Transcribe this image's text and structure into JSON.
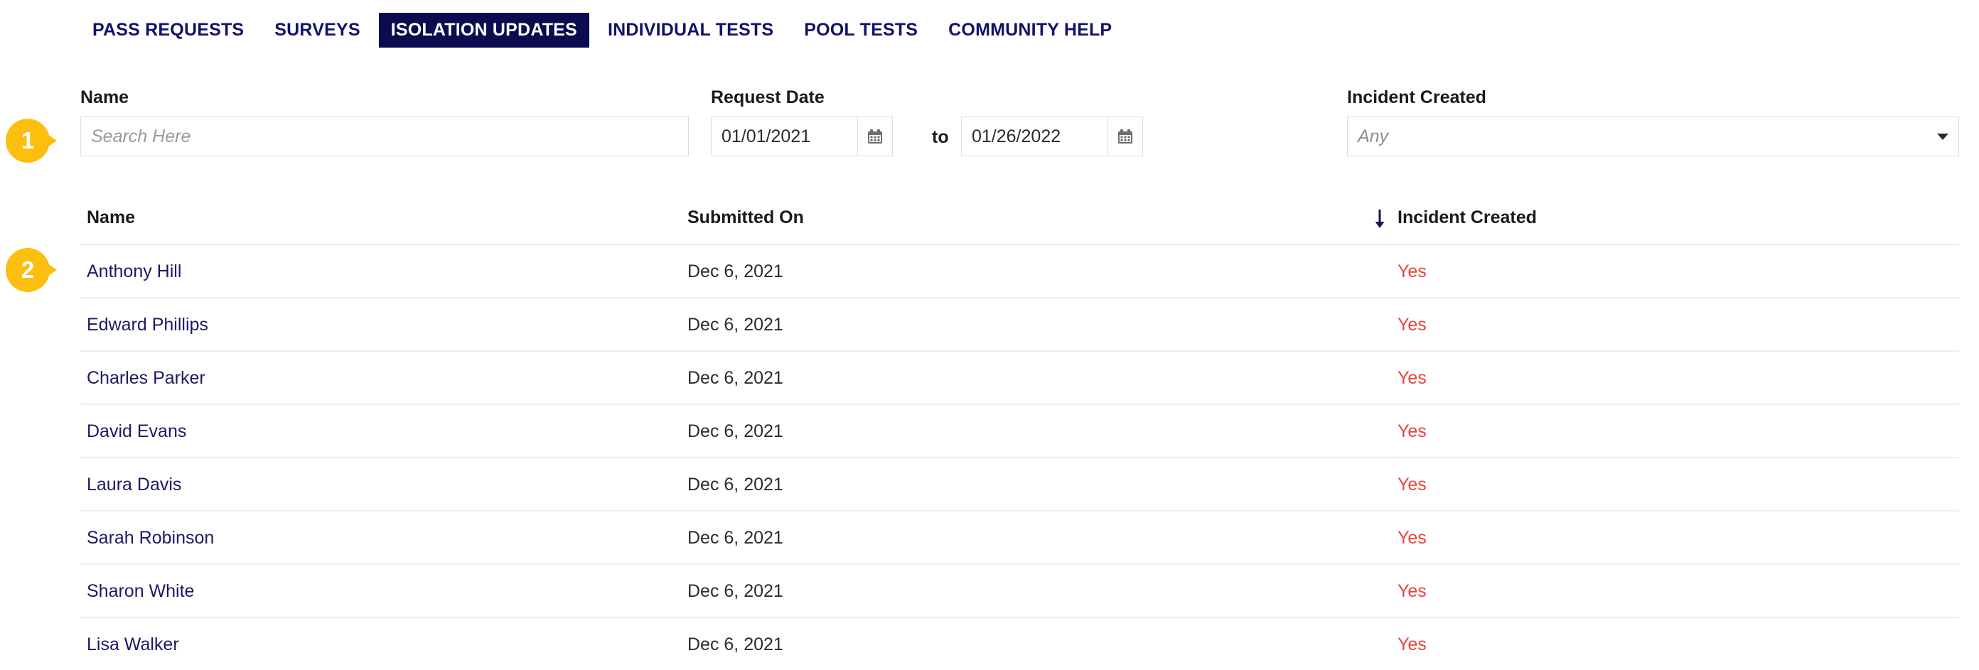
{
  "tabs": [
    {
      "label": "PASS REQUESTS",
      "active": false
    },
    {
      "label": "SURVEYS",
      "active": false
    },
    {
      "label": "ISOLATION UPDATES",
      "active": true
    },
    {
      "label": "INDIVIDUAL TESTS",
      "active": false
    },
    {
      "label": "POOL TESTS",
      "active": false
    },
    {
      "label": "COMMUNITY HELP",
      "active": false
    }
  ],
  "filters": {
    "name_label": "Name",
    "name_placeholder": "Search Here",
    "name_value": "",
    "request_date_label": "Request Date",
    "date_from": "01/01/2021",
    "date_to": "01/26/2022",
    "to_word": "to",
    "calendar_icon": "calendar-icon",
    "incident_label": "Incident Created",
    "incident_value": "Any",
    "incident_placeholder": "Any",
    "dropdown_icon": "chevron-down-icon"
  },
  "table": {
    "columns": {
      "name": "Name",
      "submitted_on": "Submitted On",
      "incident_created": "Incident Created"
    },
    "sort": {
      "icon": "arrow-down-icon",
      "column": "Incident Created",
      "direction": "desc"
    },
    "rows": [
      {
        "name": "Anthony Hill",
        "submitted_on": "Dec 6, 2021",
        "incident_created": "Yes"
      },
      {
        "name": "Edward Phillips",
        "submitted_on": "Dec 6, 2021",
        "incident_created": "Yes"
      },
      {
        "name": "Charles Parker",
        "submitted_on": "Dec 6, 2021",
        "incident_created": "Yes"
      },
      {
        "name": "David Evans",
        "submitted_on": "Dec 6, 2021",
        "incident_created": "Yes"
      },
      {
        "name": "Laura Davis",
        "submitted_on": "Dec 6, 2021",
        "incident_created": "Yes"
      },
      {
        "name": "Sarah Robinson",
        "submitted_on": "Dec 6, 2021",
        "incident_created": "Yes"
      },
      {
        "name": "Sharon White",
        "submitted_on": "Dec 6, 2021",
        "incident_created": "Yes"
      },
      {
        "name": "Lisa Walker",
        "submitted_on": "Dec 6, 2021",
        "incident_created": "Yes"
      }
    ]
  },
  "markers": [
    {
      "number": "1"
    },
    {
      "number": "2"
    }
  ],
  "colors": {
    "navy": "#0b0b4f",
    "link_navy": "#1b1b63",
    "amber": "#fcbf10",
    "red": "#e8413f",
    "border": "#dcdcdc",
    "row_divider": "#eceef0"
  }
}
